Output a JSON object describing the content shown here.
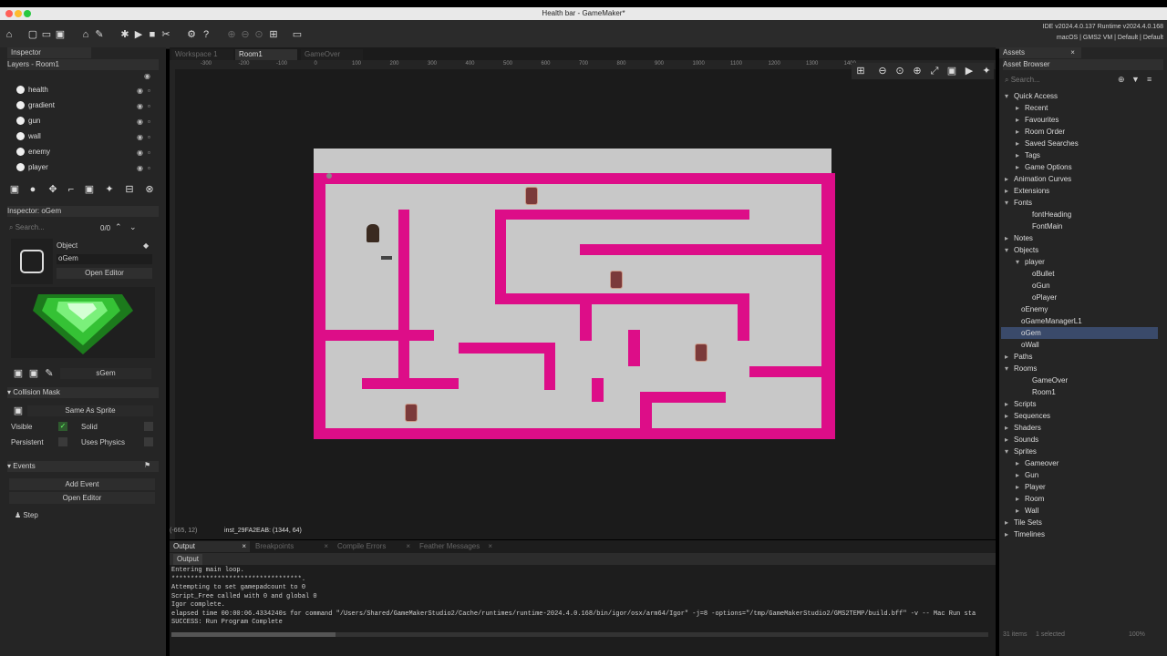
{
  "window": {
    "title": "Health bar - GameMaker*"
  },
  "ide_info": {
    "line1": "IDE v2024.4.0.137  Runtime v2024.4.0.168",
    "line2": "macOS | GMS2 VM | Default | Default"
  },
  "left_panel": {
    "inspector_tab": "Inspector",
    "layers_header": "Layers - Room1",
    "layers": [
      "health",
      "gradient",
      "gun",
      "wall",
      "enemy",
      "player"
    ],
    "inspector_header": "Inspector: oGem",
    "search_placeholder": "Search...",
    "search_count": "0/0",
    "object_label": "Object",
    "object_name": "oGem",
    "open_editor": "Open Editor",
    "sprite_name": "sGem",
    "collision_mask": "Collision Mask",
    "same_as_sprite": "Same As Sprite",
    "visible": "Visible",
    "solid": "Solid",
    "persistent": "Persistent",
    "uses_physics": "Uses Physics",
    "events": "Events",
    "add_event": "Add Event",
    "open_editor2": "Open Editor",
    "step": "Step"
  },
  "room_tabs": [
    "Workspace 1",
    "Room1",
    "GameOver"
  ],
  "ruler_labels": [
    "-300",
    "-200",
    "-100",
    "0",
    "100",
    "200",
    "300",
    "400",
    "500",
    "600",
    "700",
    "800",
    "900",
    "1000",
    "1100",
    "1200",
    "1300",
    "1400"
  ],
  "status": {
    "coords": "(-665, 12)",
    "instance": "inst_29FA2EAB: (1344, 64)"
  },
  "output": {
    "tabs": [
      "Output",
      "Breakpoints",
      "Compile Errors",
      "Feather Messages"
    ],
    "subtab": "Output",
    "lines": [
      "Entering main loop.",
      "**********************************.",
      "Attempting to set gamepadcount to 0",
      "Script_Free called with 0 and global 0",
      "Igor complete.",
      "elapsed time 00:00:06.4334240s for command \"/Users/Shared/GameMakerStudio2/Cache/runtimes/runtime-2024.4.0.168/bin/igor/osx/arm64/Igor\" -j=8  -options=\"/tmp/GameMakerStudio2/GMS2TEMP/build.bff\" -v -- Mac Run sta",
      "SUCCESS: Run Program Complete"
    ]
  },
  "assets": {
    "tab": "Assets",
    "browser": "Asset Browser",
    "search_placeholder": "Search...",
    "items": [
      {
        "label": "Quick Access",
        "indent": 0,
        "arrow": "▾"
      },
      {
        "label": "Recent",
        "indent": 1,
        "arrow": "▸"
      },
      {
        "label": "Favourites",
        "indent": 1,
        "arrow": "▸"
      },
      {
        "label": "Room Order",
        "indent": 1,
        "arrow": "▸"
      },
      {
        "label": "Saved Searches",
        "indent": 1,
        "arrow": "▸"
      },
      {
        "label": "Tags",
        "indent": 1,
        "arrow": "▸"
      },
      {
        "label": "Game Options",
        "indent": 1,
        "arrow": "▸"
      },
      {
        "label": "Animation Curves",
        "indent": 0,
        "arrow": "▸"
      },
      {
        "label": "Extensions",
        "indent": 0,
        "arrow": "▸"
      },
      {
        "label": "Fonts",
        "indent": 0,
        "arrow": "▾"
      },
      {
        "label": "fontHeading",
        "indent": 2,
        "arrow": ""
      },
      {
        "label": "FontMain",
        "indent": 2,
        "arrow": ""
      },
      {
        "label": "Notes",
        "indent": 0,
        "arrow": "▸"
      },
      {
        "label": "Objects",
        "indent": 0,
        "arrow": "▾"
      },
      {
        "label": "player",
        "indent": 1,
        "arrow": "▾"
      },
      {
        "label": "oBullet",
        "indent": 2,
        "arrow": ""
      },
      {
        "label": "oGun",
        "indent": 2,
        "arrow": ""
      },
      {
        "label": "oPlayer",
        "indent": 2,
        "arrow": ""
      },
      {
        "label": "oEnemy",
        "indent": 1,
        "arrow": ""
      },
      {
        "label": "oGameManagerL1",
        "indent": 1,
        "arrow": ""
      },
      {
        "label": "oGem",
        "indent": 1,
        "arrow": ""
      },
      {
        "label": "oWall",
        "indent": 1,
        "arrow": ""
      },
      {
        "label": "Paths",
        "indent": 0,
        "arrow": "▸"
      },
      {
        "label": "Rooms",
        "indent": 0,
        "arrow": "▾"
      },
      {
        "label": "GameOver",
        "indent": 2,
        "arrow": ""
      },
      {
        "label": "Room1",
        "indent": 2,
        "arrow": ""
      },
      {
        "label": "Scripts",
        "indent": 0,
        "arrow": "▸"
      },
      {
        "label": "Sequences",
        "indent": 0,
        "arrow": "▸"
      },
      {
        "label": "Shaders",
        "indent": 0,
        "arrow": "▸"
      },
      {
        "label": "Sounds",
        "indent": 0,
        "arrow": "▸"
      },
      {
        "label": "Sprites",
        "indent": 0,
        "arrow": "▾"
      },
      {
        "label": "Gameover",
        "indent": 1,
        "arrow": "▸"
      },
      {
        "label": "Gun",
        "indent": 1,
        "arrow": "▸"
      },
      {
        "label": "Player",
        "indent": 1,
        "arrow": "▸"
      },
      {
        "label": "Room",
        "indent": 1,
        "arrow": "▸"
      },
      {
        "label": "Wall",
        "indent": 1,
        "arrow": "▸"
      },
      {
        "label": "Tile Sets",
        "indent": 0,
        "arrow": "▸"
      },
      {
        "label": "Timelines",
        "indent": 0,
        "arrow": "▸"
      }
    ],
    "footer_items": "31 items",
    "footer_selected": "1 selected",
    "footer_zoom": "100%"
  }
}
